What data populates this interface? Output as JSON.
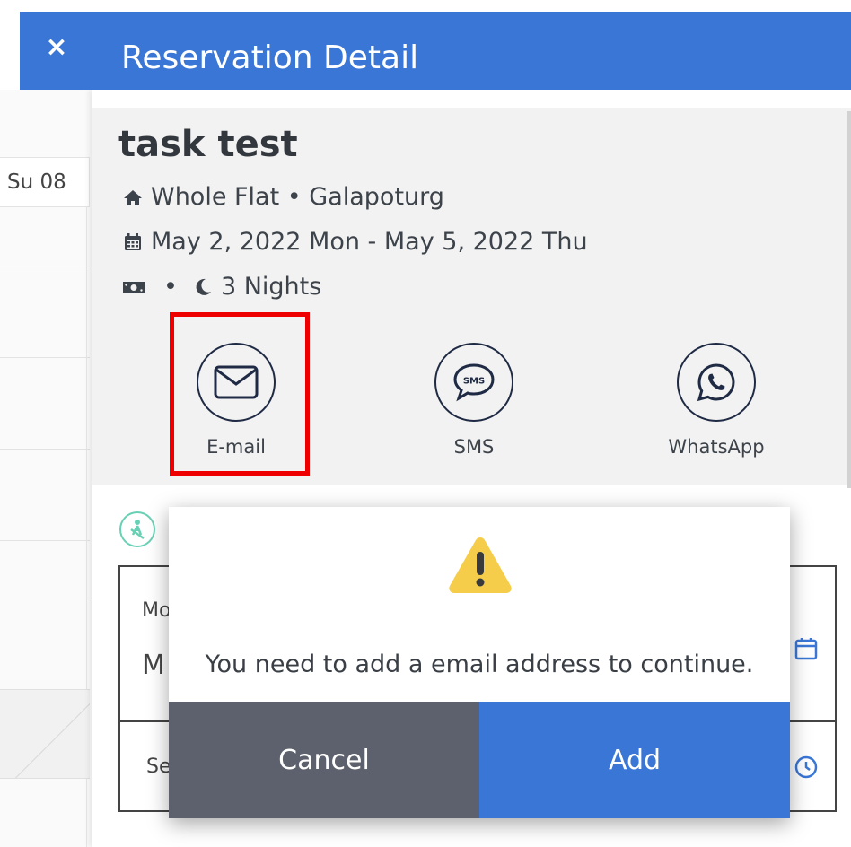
{
  "calendar": {
    "day_label": "Su 08"
  },
  "header": {
    "close_label": "×",
    "title": "Reservation Detail"
  },
  "reservation": {
    "title": "task test",
    "property": "Whole Flat • Galapoturg",
    "dates": "May 2, 2022 Mon - May 5, 2022 Thu",
    "price_separator": "•",
    "nights": "3 Nights"
  },
  "contact_options": [
    {
      "label": "E-mail",
      "icon": "envelope-icon"
    },
    {
      "label": "SMS",
      "icon": "sms-bubble-icon"
    },
    {
      "label": "WhatsApp",
      "icon": "whatsapp-icon"
    }
  ],
  "form": {
    "frag_top_label": "Mo",
    "frag_top_value": "M",
    "frag_bottom_label": "Se"
  },
  "modal": {
    "icon": "warning-icon",
    "message": "You need to add a email address to continue.",
    "cancel_label": "Cancel",
    "add_label": "Add"
  },
  "colors": {
    "primary": "#3a76d6",
    "cancel": "#5c616d",
    "highlight": "#ee0000",
    "warning": "#f6cd4a"
  }
}
